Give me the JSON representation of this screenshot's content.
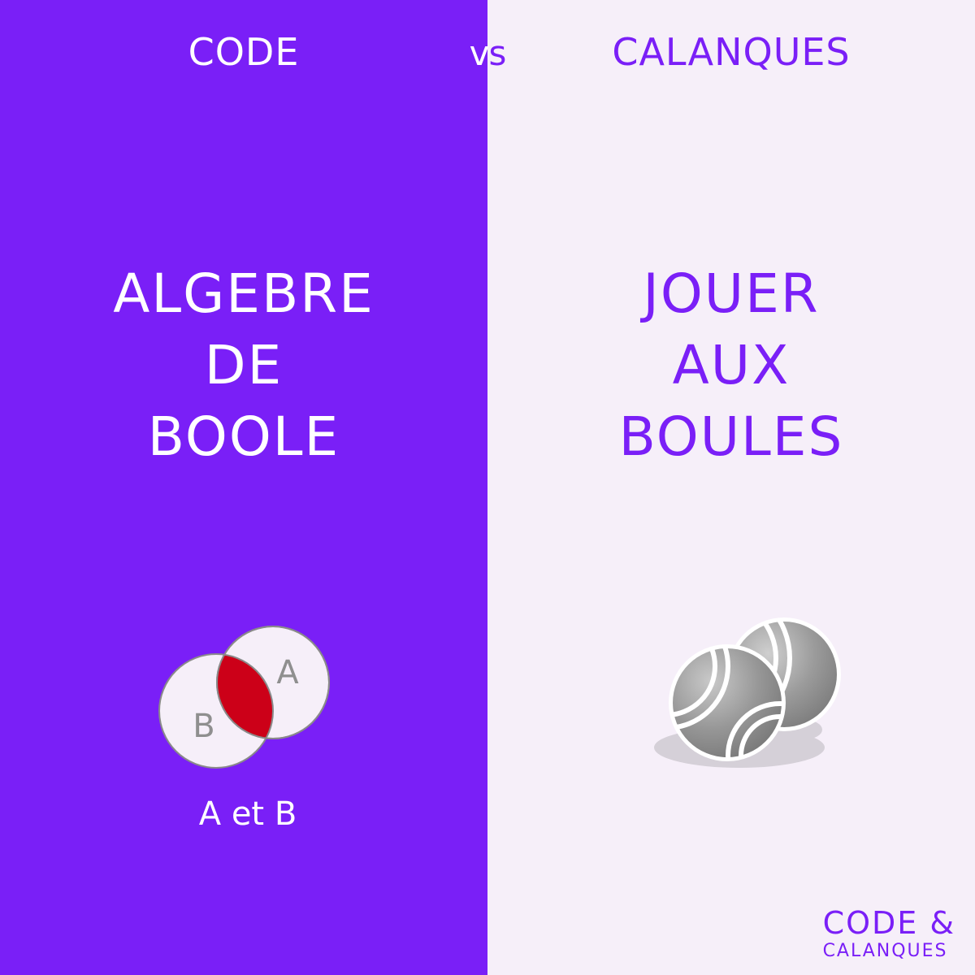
{
  "header": {
    "left_label": "CODE",
    "vs_v": "v",
    "vs_s": "s",
    "right_label": "CALANQUES"
  },
  "left": {
    "title_lines": [
      "ALGEBRE",
      "DE",
      "BOOLE"
    ],
    "venn": {
      "label_a": "A",
      "label_b": "B",
      "caption": "A et B",
      "highlight_color": "#cc0018"
    }
  },
  "right": {
    "title_lines": [
      "JOUER",
      "AUX",
      "BOULES"
    ],
    "illustration_icon": "petanque-balls-icon"
  },
  "logo": {
    "line1": "CODE &",
    "line2": "CALANQUES"
  },
  "colors": {
    "purple": "#7a1ff7",
    "light": "#f6eff9",
    "white": "#ffffff"
  }
}
